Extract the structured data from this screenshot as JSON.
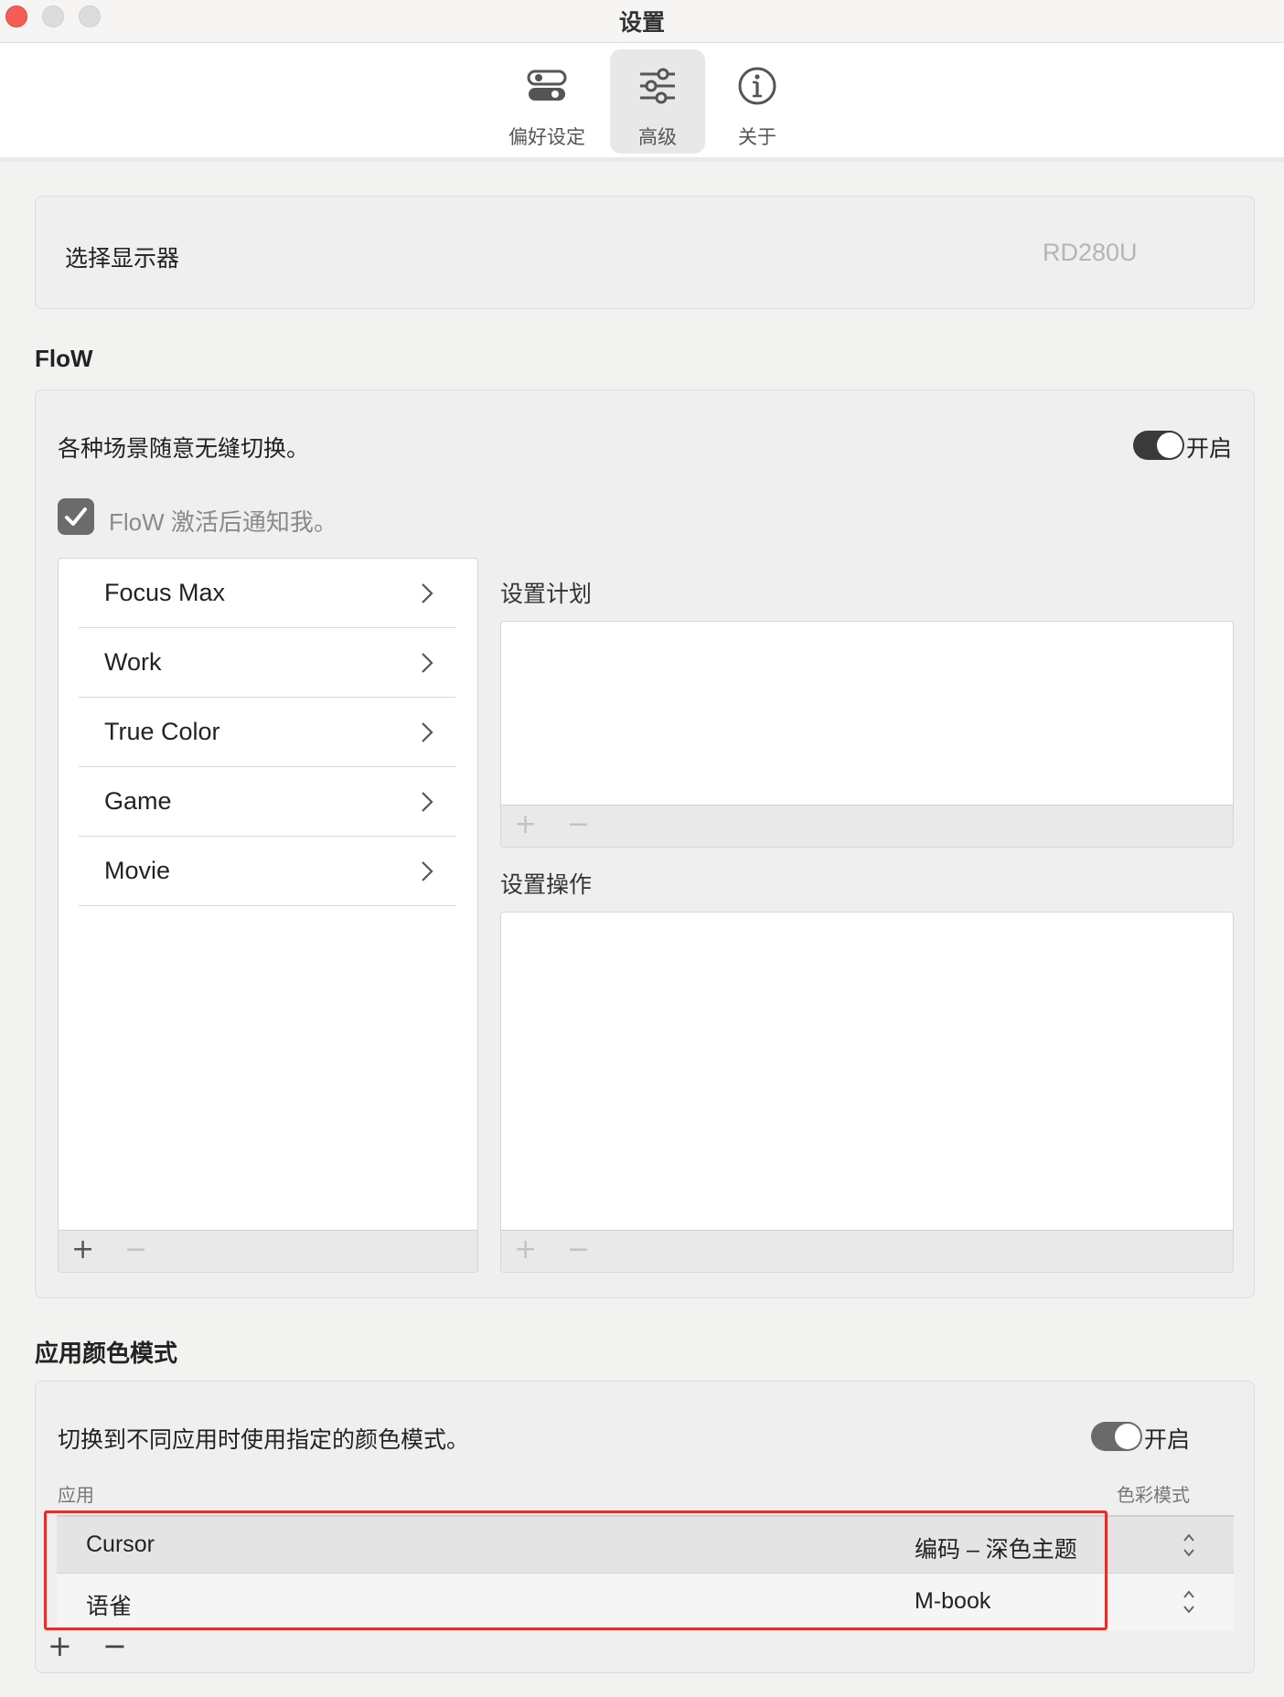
{
  "window": {
    "title": "设置"
  },
  "toolbar": {
    "tabs": [
      {
        "label": "偏好设定",
        "icon": "toggles-icon"
      },
      {
        "label": "高级",
        "icon": "sliders-icon",
        "active": true
      },
      {
        "label": "关于",
        "icon": "info-icon"
      }
    ]
  },
  "display": {
    "label": "选择显示器",
    "value": "RD280U"
  },
  "flow": {
    "section_title": "FloW",
    "description": "各种场景随意无缝切换。",
    "toggle_label": "开启",
    "toggle_on": true,
    "notify_label": "FloW 激活后通知我。",
    "notify_checked": true,
    "items": [
      "Focus Max",
      "Work",
      "True Color",
      "Game",
      "Movie"
    ],
    "plan_title": "设置计划",
    "action_title": "设置操作",
    "add_symbol": "+",
    "remove_symbol": "−"
  },
  "app_color": {
    "section_title": "应用颜色模式",
    "description": "切换到不同应用时使用指定的颜色模式。",
    "toggle_label": "开启",
    "toggle_on": true,
    "column_app": "应用",
    "column_mode": "色彩模式",
    "rows": [
      {
        "app": "Cursor",
        "mode": "编码 – 深色主题"
      },
      {
        "app": "语雀",
        "mode": "M-book"
      }
    ],
    "add_symbol": "+",
    "remove_symbol": "−"
  },
  "colors": {
    "accent_toggle": "#3a3a3a",
    "highlight": "#e0302c",
    "close_button": "#f35f57"
  }
}
